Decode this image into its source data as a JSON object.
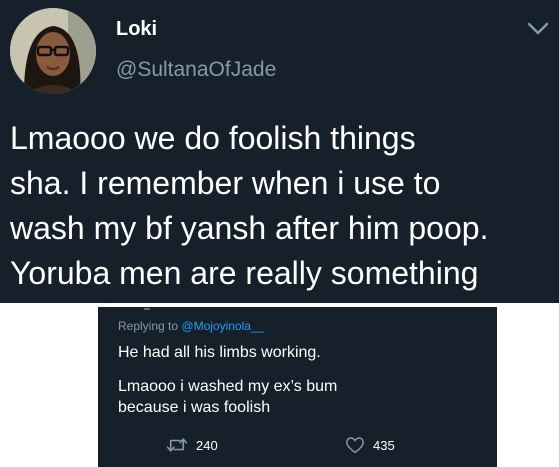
{
  "tweet": {
    "display_name": "Loki",
    "handle": "@SultanaOfJade",
    "text_lines": [
      "Lmaooo we do foolish things",
      "sha. I remember when i use to",
      "wash my bf yansh after him poop.",
      "Yoruba men are really something"
    ],
    "avatar_icon": "profile-photo",
    "menu_icon": "chevron-down-icon"
  },
  "reply": {
    "replying_to_label": "Replying to",
    "replying_to_handle": "@Mojoyinola__",
    "line1": "He had all his limbs working.",
    "line2": [
      "Lmaooo i washed my ex’s bum",
      "because i was foolish"
    ],
    "retweet_count": "240",
    "like_count": "435",
    "retweet_icon": "retweet-icon",
    "like_icon": "heart-icon"
  },
  "colors": {
    "background": "#15202b",
    "secondary_text": "#8899a6",
    "link": "#1da1f2",
    "primary_text": "#ffffff"
  }
}
